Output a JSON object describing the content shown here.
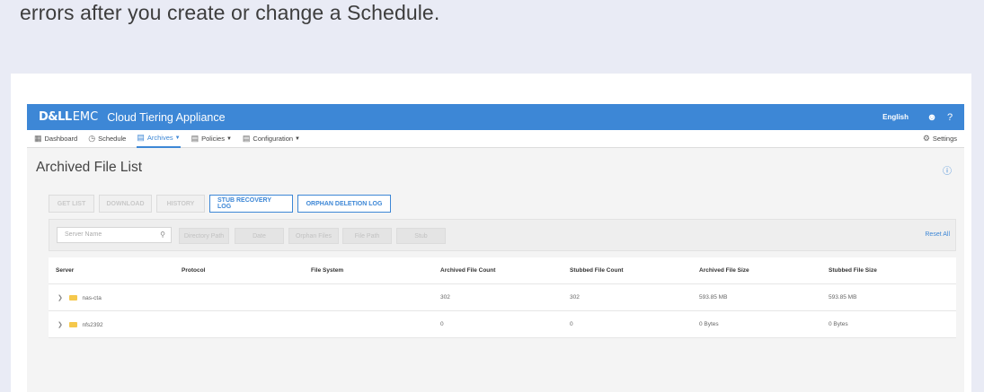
{
  "doc_text": "errors after you create or change a Schedule.",
  "topbar": {
    "logo_dell": "D&LL",
    "logo_emc": "EMC",
    "app_title": "Cloud Tiering Appliance",
    "language": "English",
    "user_icon": "user-icon",
    "help_icon": "help-icon",
    "bg_color": "#3d87d6"
  },
  "nav": {
    "items": [
      {
        "label": "Dashboard",
        "icon": "dashboard-icon"
      },
      {
        "label": "Schedule",
        "icon": "clock-icon"
      },
      {
        "label": "Archives",
        "icon": "archive-icon"
      },
      {
        "label": "Policies",
        "icon": "policy-icon"
      },
      {
        "label": "Configuration",
        "icon": "config-icon"
      }
    ],
    "settings": "Settings"
  },
  "page": {
    "title": "Archived File List"
  },
  "buttons": [
    "GET LIST",
    "DOWNLOAD",
    "HISTORY",
    "STUB RECOVERY LOG",
    "ORPHAN DELETION LOG"
  ],
  "filters": {
    "search_placeholder": "Server Name",
    "chips": [
      "Directory Path",
      "Date",
      "Orphan Files",
      "File Path",
      "Stub"
    ],
    "reset": "Reset All"
  },
  "table": {
    "headers": [
      "Server",
      "Protocol",
      "File System",
      "Archived File Count",
      "Stubbed File Count",
      "Archived File Size",
      "Stubbed File Size"
    ],
    "rows": [
      {
        "server": "nas-cta",
        "protocol": "",
        "file_system": "",
        "archived_count": "302",
        "stubbed_count": "302",
        "archived_size": "593.85 MB",
        "stubbed_size": "593.85 MB"
      },
      {
        "server": "nfs2392",
        "protocol": "",
        "file_system": "",
        "archived_count": "0",
        "stubbed_count": "0",
        "archived_size": "0 Bytes",
        "stubbed_size": "0 Bytes"
      }
    ]
  }
}
